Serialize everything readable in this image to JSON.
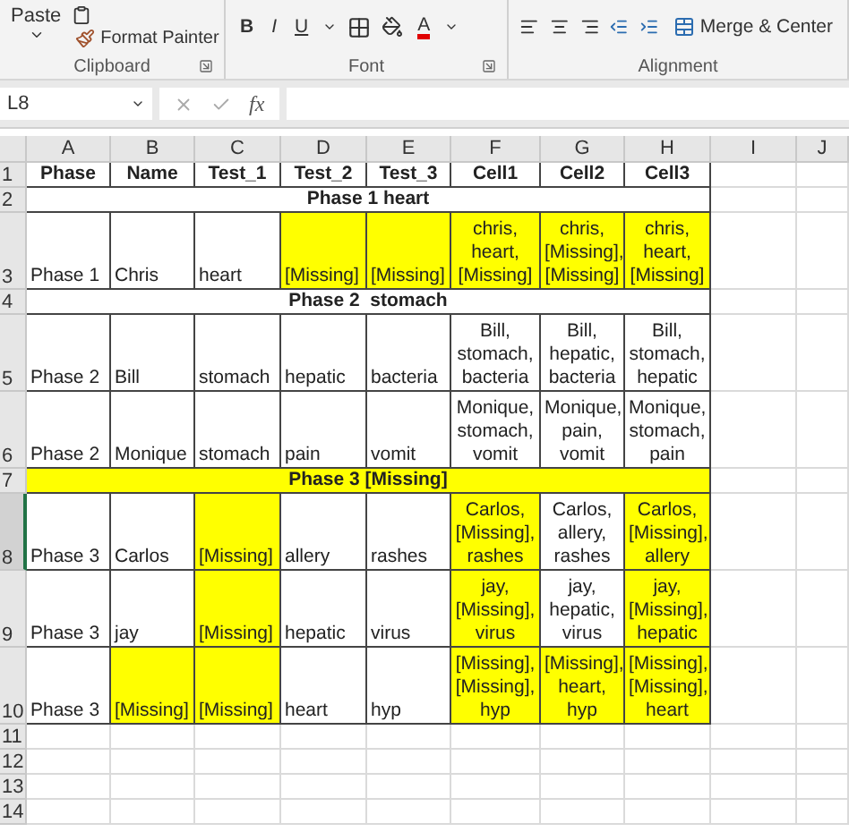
{
  "ribbon": {
    "clipboard": {
      "paste_label": "Paste",
      "format_painter_label": "Format Painter",
      "group_label": "Clipboard"
    },
    "font": {
      "buttons": [
        {
          "label": "B",
          "kind": "bold"
        },
        {
          "label": "I",
          "kind": "italic"
        },
        {
          "label": "U",
          "kind": "underline"
        }
      ],
      "font_color_label": "A",
      "group_label": "Font"
    },
    "alignment": {
      "merge_label": "Merge & Center",
      "group_label": "Alignment"
    }
  },
  "formula_bar": {
    "name_box": "L8",
    "function_label": "fx"
  },
  "columns": [
    "A",
    "B",
    "C",
    "D",
    "E",
    "F",
    "G",
    "H",
    "I",
    "J"
  ],
  "rows": [
    {
      "number": "1",
      "selected": false,
      "kind": "header",
      "cells": [
        "Phase",
        "Name",
        "Test_1",
        "Test_2",
        "Test_3",
        "Cell1",
        "Cell2",
        "Cell3"
      ]
    },
    {
      "number": "2",
      "selected": false,
      "kind": "section",
      "text": "Phase 1 heart",
      "highlighted": false
    },
    {
      "number": "3",
      "selected": false,
      "kind": "data",
      "cells": [
        {
          "text": "Phase 1",
          "highlighted": false
        },
        {
          "text": "Chris",
          "highlighted": false
        },
        {
          "text": "heart",
          "highlighted": false
        },
        {
          "text": "[Missing]",
          "highlighted": true
        },
        {
          "text": "[Missing]",
          "highlighted": true
        },
        {
          "text": "chris,\nheart,\n[Missing]",
          "highlighted": true
        },
        {
          "text": "chris,\n[Missing],\n[Missing]",
          "highlighted": true
        },
        {
          "text": "chris,\nheart,\n[Missing]",
          "highlighted": true
        }
      ]
    },
    {
      "number": "4",
      "selected": false,
      "kind": "section",
      "text": "Phase 2  stomach",
      "highlighted": false
    },
    {
      "number": "5",
      "selected": false,
      "kind": "data",
      "cells": [
        {
          "text": "Phase 2",
          "highlighted": false
        },
        {
          "text": "Bill",
          "highlighted": false
        },
        {
          "text": "stomach",
          "highlighted": false
        },
        {
          "text": "hepatic",
          "highlighted": false
        },
        {
          "text": "bacteria",
          "highlighted": false
        },
        {
          "text": "Bill,\nstomach,\nbacteria",
          "highlighted": false
        },
        {
          "text": "Bill,\nhepatic,\nbacteria",
          "highlighted": false
        },
        {
          "text": "Bill,\nstomach,\nhepatic",
          "highlighted": false
        }
      ]
    },
    {
      "number": "6",
      "selected": false,
      "kind": "data",
      "cells": [
        {
          "text": "Phase 2",
          "highlighted": false
        },
        {
          "text": "Monique",
          "highlighted": false
        },
        {
          "text": "stomach",
          "highlighted": false
        },
        {
          "text": "pain",
          "highlighted": false
        },
        {
          "text": "vomit",
          "highlighted": false
        },
        {
          "text": "Monique,\nstomach,\nvomit",
          "highlighted": false
        },
        {
          "text": "Monique,\npain,\nvomit",
          "highlighted": false
        },
        {
          "text": "Monique,\nstomach,\npain",
          "highlighted": false
        }
      ]
    },
    {
      "number": "7",
      "selected": false,
      "kind": "section",
      "text": "Phase 3 [Missing]",
      "highlighted": true
    },
    {
      "number": "8",
      "selected": true,
      "kind": "data",
      "cells": [
        {
          "text": "Phase 3",
          "highlighted": false
        },
        {
          "text": "Carlos",
          "highlighted": false
        },
        {
          "text": "[Missing]",
          "highlighted": true
        },
        {
          "text": "allery",
          "highlighted": false
        },
        {
          "text": "rashes",
          "highlighted": false
        },
        {
          "text": "Carlos,\n[Missing],\nrashes",
          "highlighted": true
        },
        {
          "text": "Carlos,\nallery,\nrashes",
          "highlighted": false
        },
        {
          "text": "Carlos,\n[Missing],\nallery",
          "highlighted": true
        }
      ]
    },
    {
      "number": "9",
      "selected": false,
      "kind": "data",
      "cells": [
        {
          "text": "Phase 3",
          "highlighted": false
        },
        {
          "text": "jay",
          "highlighted": false
        },
        {
          "text": "[Missing]",
          "highlighted": true
        },
        {
          "text": "hepatic",
          "highlighted": false
        },
        {
          "text": "virus",
          "highlighted": false
        },
        {
          "text": "jay,\n[Missing],\nvirus",
          "highlighted": true
        },
        {
          "text": "jay,\nhepatic,\nvirus",
          "highlighted": false
        },
        {
          "text": "jay,\n[Missing],\nhepatic",
          "highlighted": true
        }
      ]
    },
    {
      "number": "10",
      "selected": false,
      "kind": "data",
      "cells": [
        {
          "text": "Phase 3",
          "highlighted": false
        },
        {
          "text": "[Missing]",
          "highlighted": true
        },
        {
          "text": "[Missing]",
          "highlighted": true
        },
        {
          "text": "heart",
          "highlighted": false
        },
        {
          "text": "hyp",
          "highlighted": false
        },
        {
          "text": "[Missing],\n[Missing],\nhyp",
          "highlighted": true
        },
        {
          "text": "[Missing],\nheart,\nhyp",
          "highlighted": true
        },
        {
          "text": "[Missing],\n[Missing],\nheart",
          "highlighted": true
        }
      ]
    },
    {
      "number": "11",
      "selected": false,
      "kind": "empty"
    },
    {
      "number": "12",
      "selected": false,
      "kind": "empty"
    },
    {
      "number": "13",
      "selected": false,
      "kind": "empty"
    },
    {
      "number": "14",
      "selected": false,
      "kind": "empty"
    }
  ]
}
